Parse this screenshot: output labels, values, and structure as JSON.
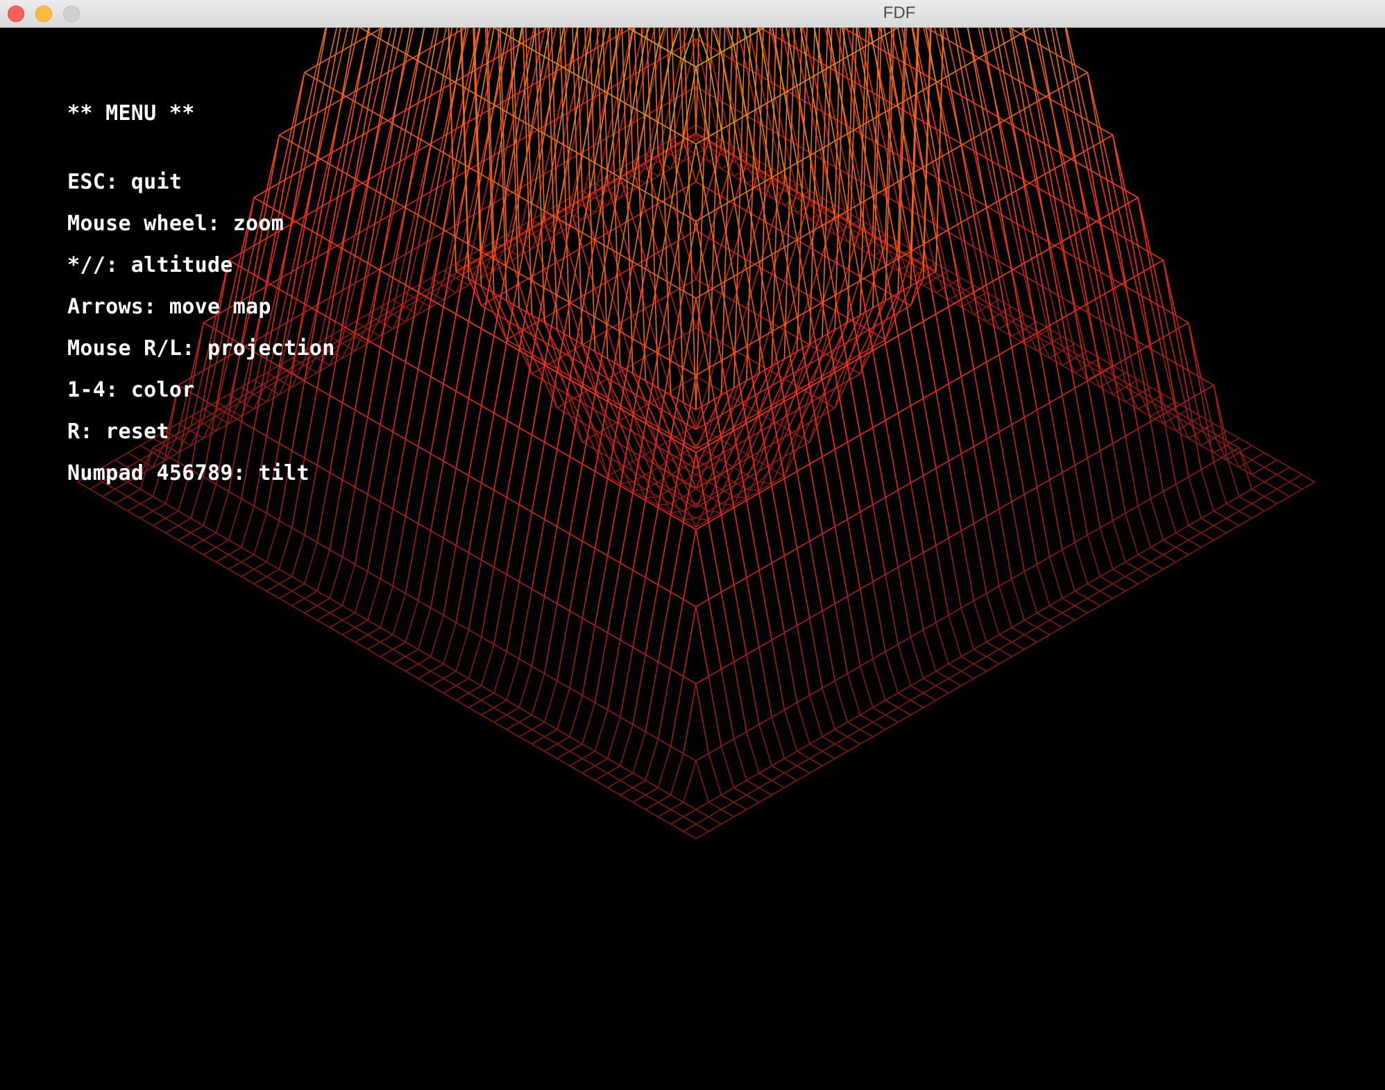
{
  "window": {
    "title": "FDF"
  },
  "menu": {
    "heading": "** MENU **",
    "items": [
      "ESC: quit",
      "Mouse wheel: zoom",
      "*//: altitude",
      "Arrows: move map",
      "Mouse R/L: projection",
      "1-4: color",
      "R: reset",
      "Numpad 456789: tilt"
    ]
  },
  "colors": {
    "background": "#000000",
    "low": "#7a1a12",
    "mid": "#ff2a1a",
    "high": "#d8b21a",
    "text": "#ffffff"
  }
}
